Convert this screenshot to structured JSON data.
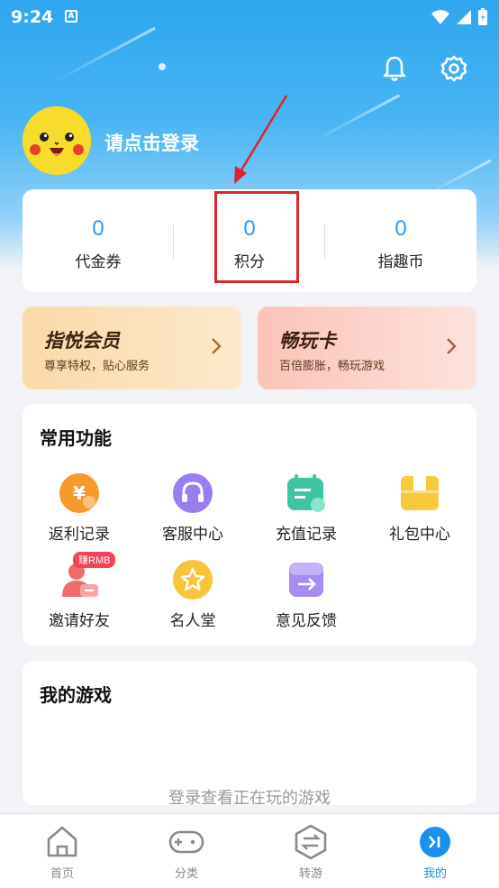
{
  "status_bar": {
    "time": "9:24",
    "notice_icon": "A"
  },
  "header": {
    "bell_icon": "bell-icon",
    "settings_icon": "gear-icon"
  },
  "profile": {
    "login_prompt": "请点击登录"
  },
  "stats": [
    {
      "value": "0",
      "label": "代金券"
    },
    {
      "value": "0",
      "label": "积分"
    },
    {
      "value": "0",
      "label": "指趣币"
    }
  ],
  "promos": {
    "vip": {
      "title": "指悦会员",
      "subtitle": "尊享特权，贴心服务"
    },
    "card": {
      "title": "畅玩卡",
      "subtitle": "百倍膨胀，畅玩游戏"
    }
  },
  "functions": {
    "title": "常用功能",
    "items": [
      {
        "label": "返利记录",
        "icon": "rebate-icon"
      },
      {
        "label": "客服中心",
        "icon": "headset-icon"
      },
      {
        "label": "充值记录",
        "icon": "recharge-icon"
      },
      {
        "label": "礼包中心",
        "icon": "gift-icon"
      },
      {
        "label": "邀请好友",
        "icon": "invite-icon",
        "badge": "赚RMB"
      },
      {
        "label": "名人堂",
        "icon": "star-icon"
      },
      {
        "label": "意见反馈",
        "icon": "feedback-icon"
      }
    ]
  },
  "my_games": {
    "title": "我的游戏",
    "empty_text": "登录查看正在玩的游戏"
  },
  "tabbar": [
    {
      "label": "首页",
      "icon": "home-icon",
      "active": false
    },
    {
      "label": "分类",
      "icon": "gamepad-icon",
      "active": false
    },
    {
      "label": "转游",
      "icon": "transfer-icon",
      "active": false
    },
    {
      "label": "我的",
      "icon": "profile-icon",
      "active": true
    }
  ],
  "colors": {
    "accent": "#1a8ff0",
    "highlight": "#d8262c",
    "number": "#2a9df4"
  }
}
